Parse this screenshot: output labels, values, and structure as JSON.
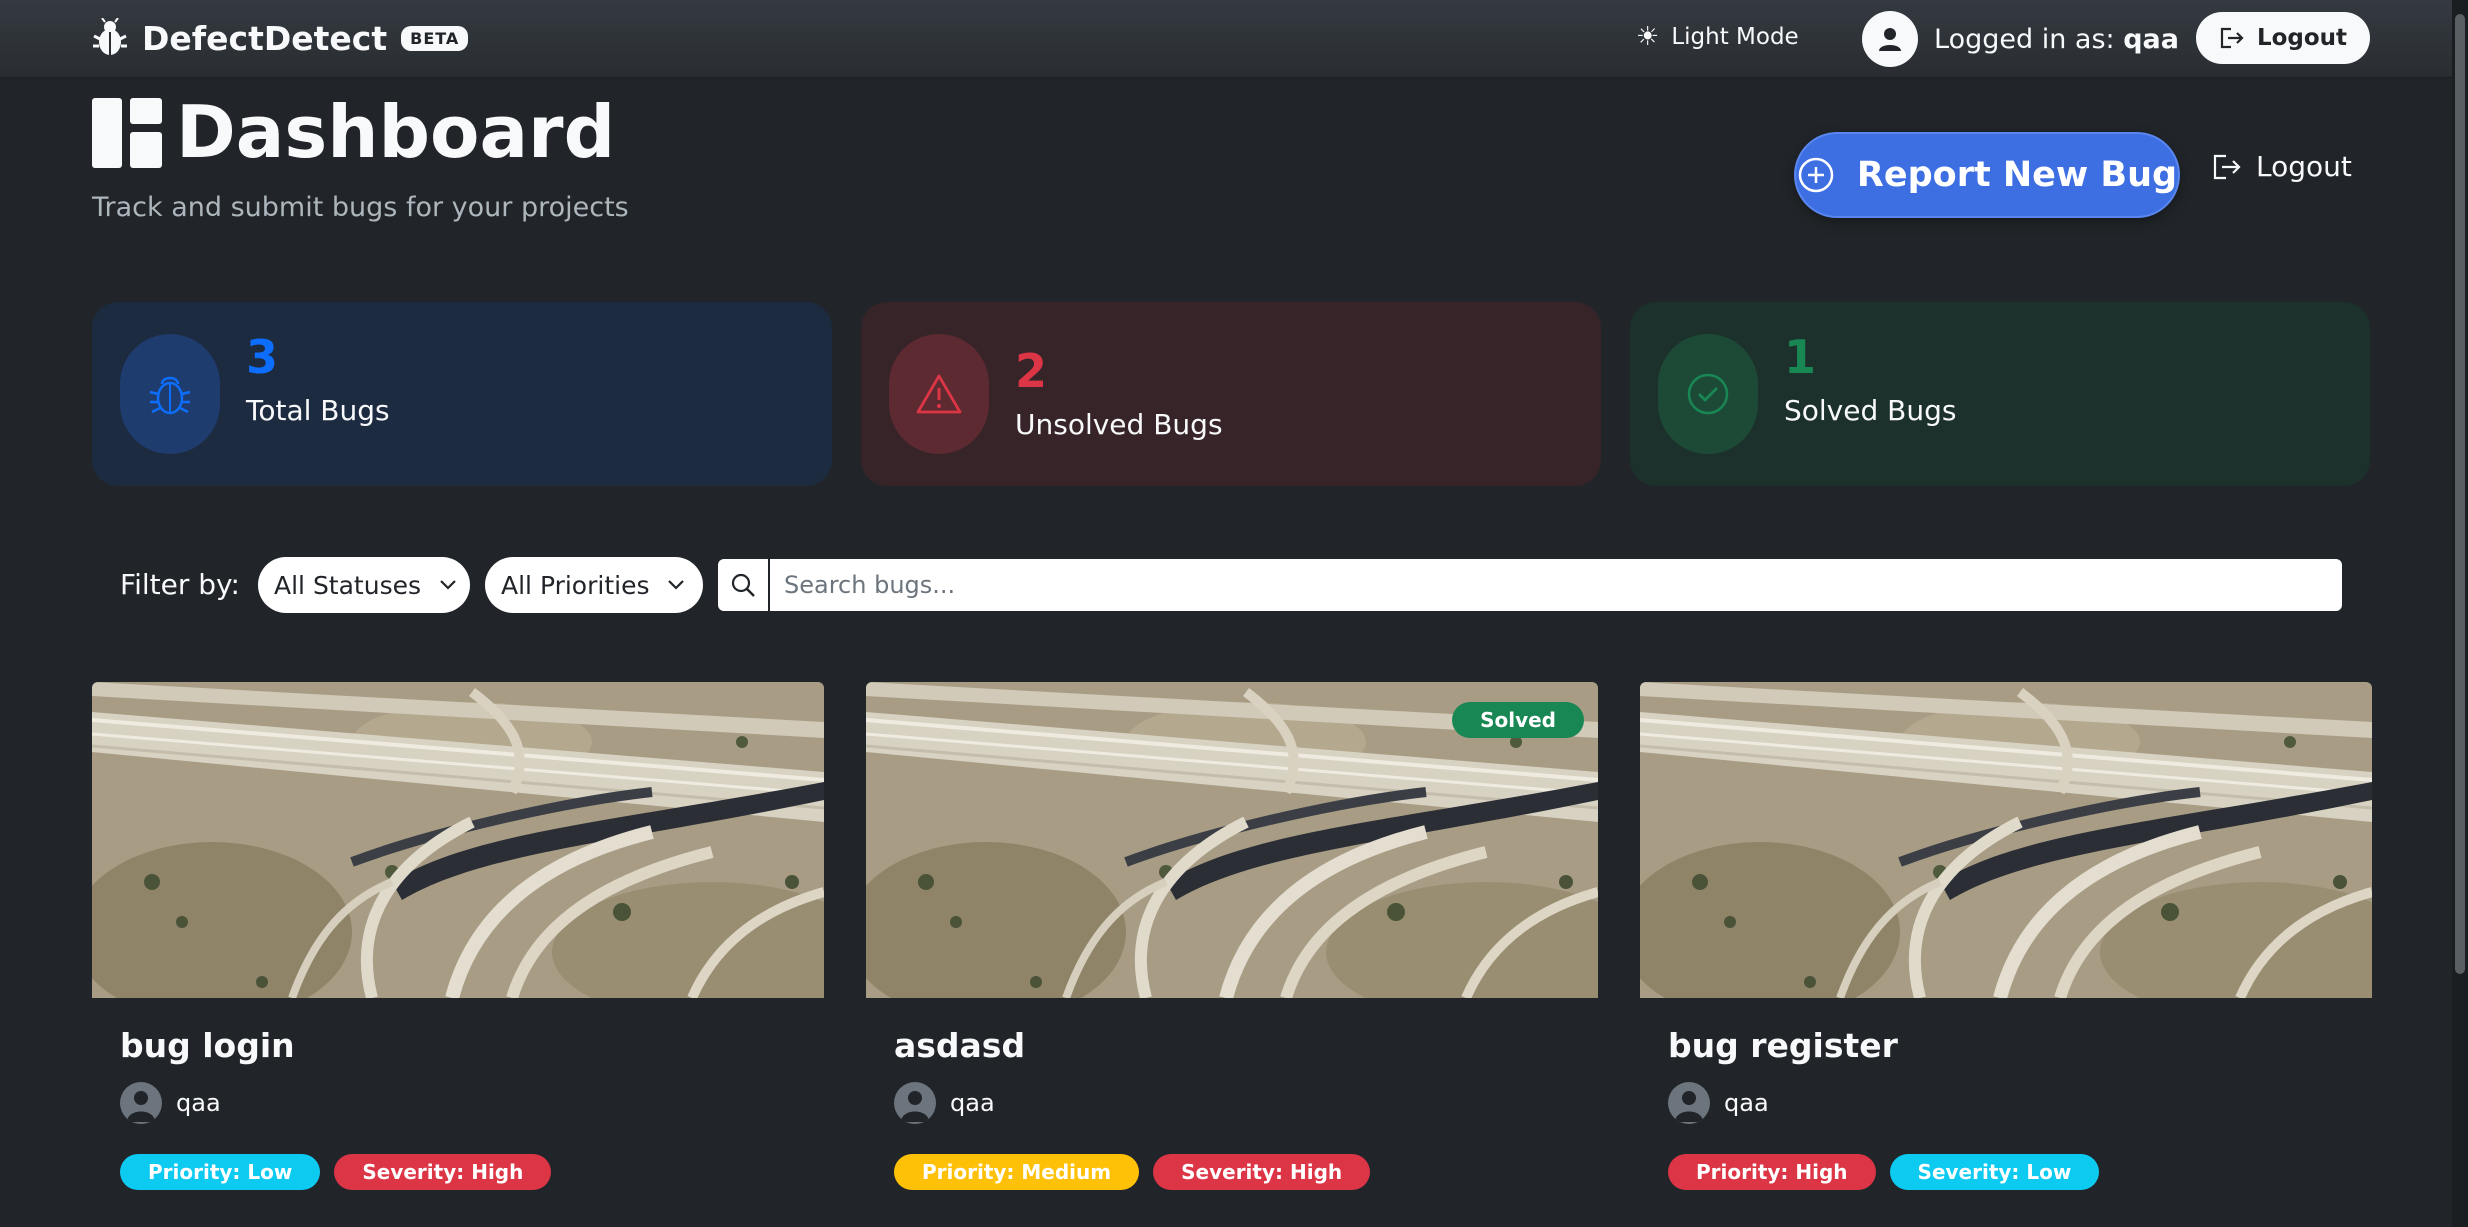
{
  "navbar": {
    "brand": "DefectDetect",
    "beta_badge": "BETA",
    "theme_toggle": "Light Mode",
    "logged_in_prefix": "Logged in as:",
    "username": "qaa",
    "logout_label": "Logout"
  },
  "header": {
    "title": "Dashboard",
    "subtitle": "Track and submit bugs for your projects",
    "report_button": "Report New Bug",
    "logout_label": "Logout"
  },
  "stats": [
    {
      "value": "3",
      "label": "Total Bugs",
      "color": "#0d6efd"
    },
    {
      "value": "2",
      "label": "Unsolved Bugs",
      "color": "#dc3545"
    },
    {
      "value": "1",
      "label": "Solved Bugs",
      "color": "#198754"
    }
  ],
  "filter": {
    "label": "Filter by:",
    "status_selected": "All Statuses",
    "priority_selected": "All Priorities",
    "search_placeholder": "Search bugs..."
  },
  "bugs": [
    {
      "title": "bug login",
      "reporter": "qaa",
      "priority": "Priority: Low",
      "severity": "Severity: High",
      "status": ""
    },
    {
      "title": "asdasd",
      "reporter": "qaa",
      "priority": "Priority: Medium",
      "severity": "Severity: High",
      "status": "Solved"
    },
    {
      "title": "bug register",
      "reporter": "qaa",
      "priority": "Priority: High",
      "severity": "Severity: Low",
      "status": ""
    }
  ],
  "colors": {
    "background": "#212529",
    "accent": "#3d6fe3",
    "low": "#0dcaf0",
    "medium": "#ffc107",
    "high": "#dc3545",
    "solved": "#198754"
  }
}
